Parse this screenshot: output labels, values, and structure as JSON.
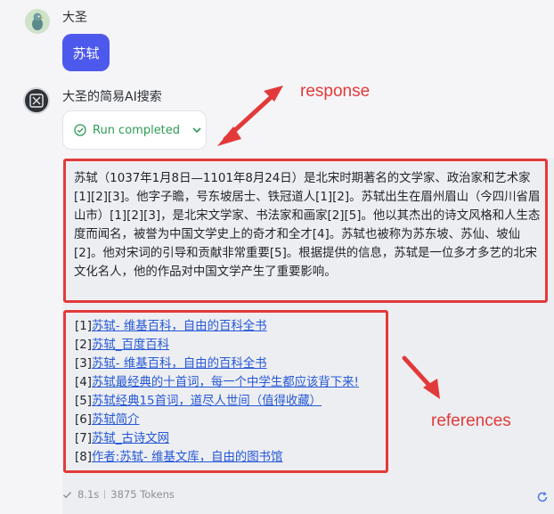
{
  "user": {
    "name": "大圣",
    "message": "苏轼"
  },
  "bot": {
    "name": "大圣的简易AI搜索",
    "status_label": "Run completed",
    "answer": "苏轼（1037年1月8日—1101年8月24日）是北宋时期著名的文学家、政治家和艺术家[1][2][3]。他字子瞻，号东坡居士、铁冠道人[1][2]。苏轼出生在眉州眉山（今四川省眉山市）[1][2][3]，是北宋文学家、书法家和画家[2][5]。他以其杰出的诗文风格和人生态度而闻名，被誉为中国文学史上的奇才和全才[4]。苏轼也被称为苏东坡、苏仙、坡仙[2]。他对宋词的引导和贡献非常重要[5]。根据提供的信息，苏轼是一位多才多艺的北宋文化名人，他的作品对中国文学产生了重要影响。",
    "references": [
      {
        "index": "[1]",
        "title": "苏轼- 维基百科，自由的百科全书"
      },
      {
        "index": "[2]",
        "title": "苏轼_百度百科"
      },
      {
        "index": "[3]",
        "title": "苏轼- 维基百科，自由的百科全书"
      },
      {
        "index": "[4]",
        "title": "苏轼最经典的十首词，每一个中学生都应该背下来!"
      },
      {
        "index": "[5]",
        "title": "苏轼经典15首词，道尽人世间（值得收藏）"
      },
      {
        "index": "[6]",
        "title": "苏轼简介"
      },
      {
        "index": "[7]",
        "title": "苏轼_古诗文网"
      },
      {
        "index": "[8]",
        "title": "作者:苏轼- 维基文库，自由的图书馆"
      }
    ],
    "meta": {
      "time": "8.1s",
      "tokens": "3875 Tokens"
    }
  },
  "annotations": {
    "response": "response",
    "references": "references"
  },
  "colors": {
    "accent": "#4d59ec",
    "success": "#2e9b56",
    "link": "#2558d6",
    "annotation": "#e23a3a"
  },
  "icons": [
    "bird-avatar-icon",
    "bot-avatar-icon",
    "check-circle-icon",
    "chevron-down-icon",
    "check-icon",
    "refresh-icon"
  ]
}
